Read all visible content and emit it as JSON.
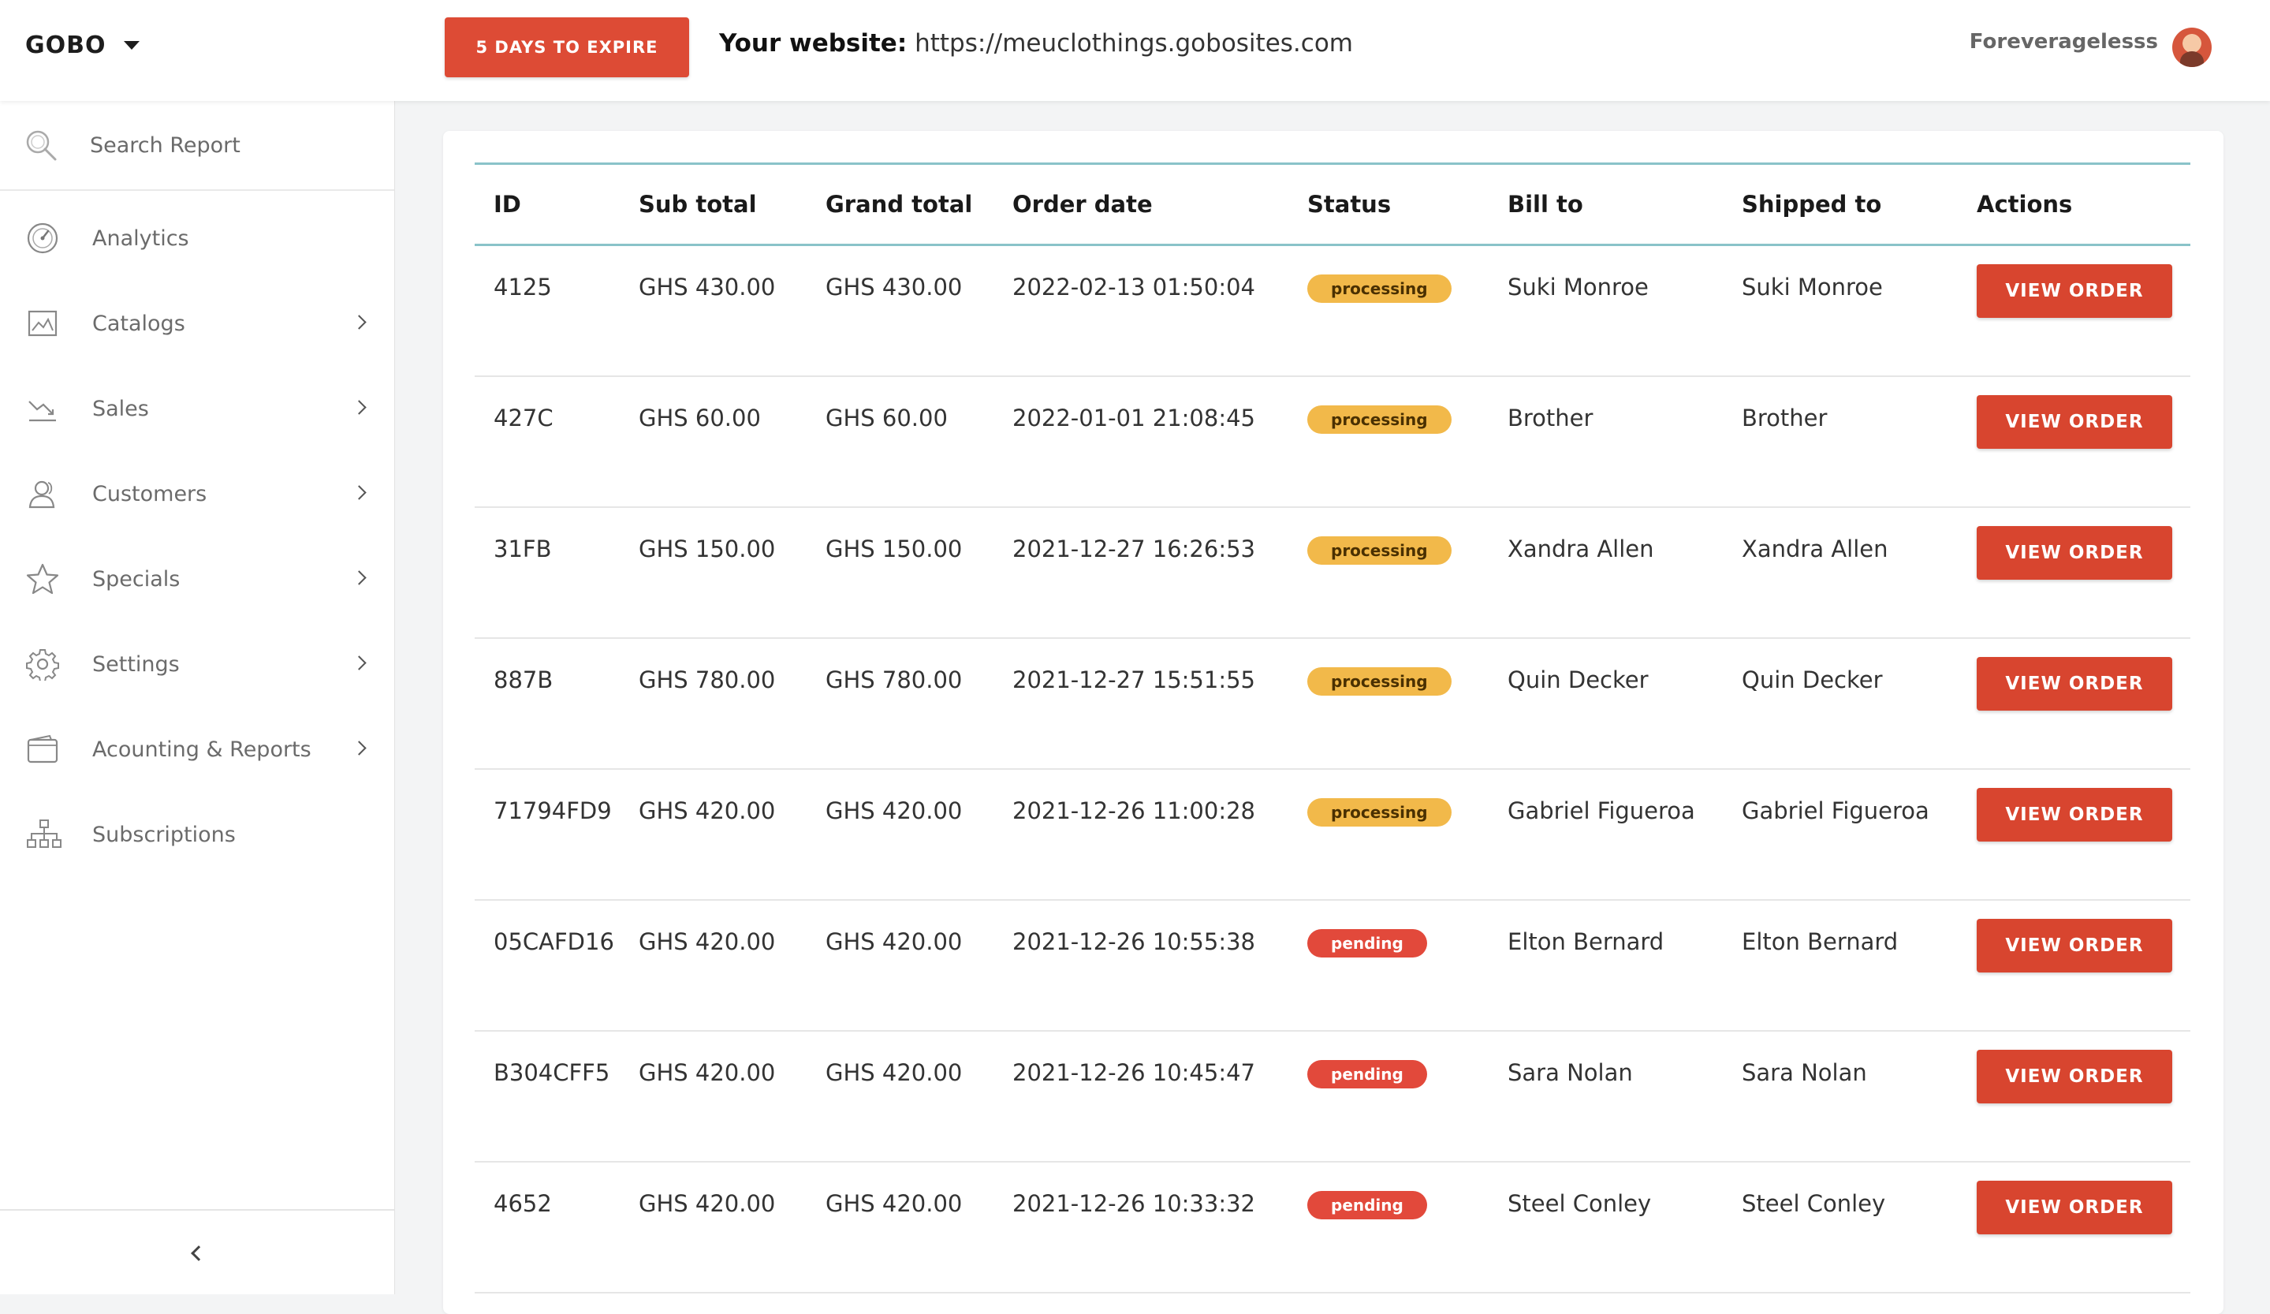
{
  "header": {
    "brand": "GOBO",
    "expire_button": "5 DAYS TO EXPIRE",
    "website_label": "Your website:",
    "website_url": "https://meuclothings.gobosites.com",
    "username": "Foreveragelesss"
  },
  "sidebar": {
    "search_placeholder": "Search Report",
    "items": [
      {
        "label": "Analytics",
        "icon": "speedometer-icon"
      },
      {
        "label": "Catalogs",
        "icon": "image-icon"
      },
      {
        "label": "Sales",
        "icon": "trending-down-icon"
      },
      {
        "label": "Customers",
        "icon": "users-icon"
      },
      {
        "label": "Specials",
        "icon": "star-icon"
      },
      {
        "label": "Settings",
        "icon": "gear-icon"
      },
      {
        "label": "Acounting & Reports",
        "icon": "wallet-icon"
      },
      {
        "label": "Subscriptions",
        "icon": "sitemap-icon"
      }
    ]
  },
  "table": {
    "columns": [
      "ID",
      "Sub total",
      "Grand total",
      "Order date",
      "Status",
      "Bill to",
      "Shipped to",
      "Actions"
    ],
    "action_label": "VIEW ORDER",
    "rows": [
      {
        "id": "4125",
        "sub_total": "GHS 430.00",
        "grand_total": "GHS 430.00",
        "order_date": "2022-02-13 01:50:04",
        "status": "processing",
        "bill_to": "Suki Monroe",
        "shipped_to": "Suki Monroe"
      },
      {
        "id": "427C",
        "sub_total": "GHS 60.00",
        "grand_total": "GHS 60.00",
        "order_date": "2022-01-01 21:08:45",
        "status": "processing",
        "bill_to": "Brother",
        "shipped_to": "Brother"
      },
      {
        "id": "31FB",
        "sub_total": "GHS 150.00",
        "grand_total": "GHS 150.00",
        "order_date": "2021-12-27 16:26:53",
        "status": "processing",
        "bill_to": "Xandra Allen",
        "shipped_to": "Xandra Allen"
      },
      {
        "id": "887B",
        "sub_total": "GHS 780.00",
        "grand_total": "GHS 780.00",
        "order_date": "2021-12-27 15:51:55",
        "status": "processing",
        "bill_to": "Quin Decker",
        "shipped_to": "Quin Decker"
      },
      {
        "id": "71794FD9",
        "sub_total": "GHS 420.00",
        "grand_total": "GHS 420.00",
        "order_date": "2021-12-26 11:00:28",
        "status": "processing",
        "bill_to": "Gabriel Figueroa",
        "shipped_to": "Gabriel Figueroa"
      },
      {
        "id": "05CAFD16",
        "sub_total": "GHS 420.00",
        "grand_total": "GHS 420.00",
        "order_date": "2021-12-26 10:55:38",
        "status": "pending",
        "bill_to": "Elton Bernard",
        "shipped_to": "Elton Bernard"
      },
      {
        "id": "B304CFF5",
        "sub_total": "GHS 420.00",
        "grand_total": "GHS 420.00",
        "order_date": "2021-12-26 10:45:47",
        "status": "pending",
        "bill_to": "Sara Nolan",
        "shipped_to": "Sara Nolan"
      },
      {
        "id": "4652",
        "sub_total": "GHS 420.00",
        "grand_total": "GHS 420.00",
        "order_date": "2021-12-26 10:33:32",
        "status": "pending",
        "bill_to": "Steel Conley",
        "shipped_to": "Steel Conley"
      }
    ]
  },
  "colors": {
    "accent": "#dd4b35",
    "processing": "#f2b94a",
    "pending": "#e2493b",
    "table_rule": "#8ac3c9"
  }
}
